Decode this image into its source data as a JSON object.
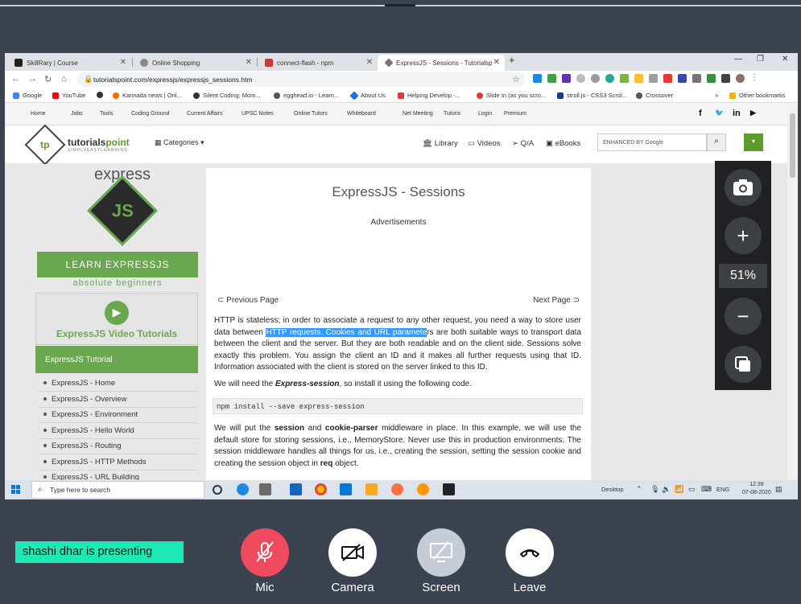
{
  "browser": {
    "tabs": [
      {
        "title": "SkillRary | Course",
        "color": "#222"
      },
      {
        "title": "Online Shopping",
        "color": "#666"
      },
      {
        "title": "connect-flash - npm",
        "color": "#cb3837"
      },
      {
        "title": "ExpressJS - Sessions - Tutorialsp",
        "color": "#777"
      }
    ],
    "tab_close": "✕",
    "new_tab": "+",
    "url": "tutorialspoint.com/expressjs/expressjs_sessions.htm",
    "bookmarks": [
      {
        "label": "Google",
        "color": "#4285f4"
      },
      {
        "label": "YouTube",
        "color": "#ff0000"
      },
      {
        "label": "",
        "color": "#333"
      },
      {
        "label": "Kannada news | Onl...",
        "color": "#ff6600"
      },
      {
        "label": "Silent Coding: Mom...",
        "color": "#333"
      },
      {
        "label": "egghead.io - Learn...",
        "color": "#555"
      },
      {
        "label": "About Us",
        "color": "#1a73e8"
      },
      {
        "label": "Helping Develop -...",
        "color": "#e53935"
      },
      {
        "label": "Slide In (as you scro...",
        "color": "#e53935"
      },
      {
        "label": "stroll.js - CSS3 Scrol...",
        "color": "#1a3a8a"
      },
      {
        "label": "Crossover",
        "color": "#555"
      }
    ],
    "bookmarks_more": "»",
    "other_bookmarks": "Other bookmarks"
  },
  "site": {
    "topnav": [
      "Home",
      "Jobs",
      "Tools",
      "Coding Ground",
      "Current Affairs",
      "UPSC Notes",
      "Online Tutors",
      "Whiteboard",
      "Net Meeting",
      "Tutorix",
      "Login",
      "Premium"
    ],
    "social": [
      "f",
      "🐦",
      "in",
      "▶"
    ],
    "logo_text_a": "tutorials",
    "logo_text_b": "point",
    "logo_tagline": "SIMPLYEASYLEARNING",
    "categories": "Categories",
    "header_links": [
      "Library",
      "Videos",
      "Q/A",
      "eBooks"
    ],
    "search_placeholder": "ENHANCED BY Google",
    "sidebar": {
      "express_word": "express",
      "js_mark": "JS",
      "learn": "LEARN EXPRESSJS",
      "absolute": "absolute beginners",
      "video_title": "ExpressJS Video Tutorials",
      "tutorial_heading": "ExpressJS Tutorial",
      "items": [
        "ExpressJS - Home",
        "ExpressJS - Overview",
        "ExpressJS - Environment",
        "ExpressJS - Hello World",
        "ExpressJS - Routing",
        "ExpressJS - HTTP Methods",
        "ExpressJS - URL Building"
      ]
    },
    "content": {
      "title": "ExpressJS - Sessions",
      "ads": "Advertisements",
      "prev": "Previous Page",
      "next": "Next Page",
      "p1_a": "HTTP is stateless; in order to associate a request to any other request, you need a way to store user data between ",
      "p1_hl": "HTTP requests. Cookies and URL paramete",
      "p1_b": "rs are both suitable ways to transport data between the client and the server. But they are both readable and on the client side. Sessions solve exactly this problem. You assign the client an ID and it makes all further requests using that ID. Information associated with the client is stored on the server linked to this ID.",
      "p2_a": "We will need the ",
      "p2_em": "Express-session",
      "p2_b": ", so install it using the following code.",
      "code": "npm install --save express-session",
      "p3_a": "We will put the ",
      "p3_b1": "session",
      "p3_c": " and ",
      "p3_b2": "cookie-parser",
      "p3_d": " middleware in place. In this example, we will use the default store for storing sessions, i.e., MemoryStore. Never use this in production environments. The session middleware handles all things for us, i.e., creating the session, setting the session cookie and creating the session object in ",
      "p3_b3": "req",
      "p3_e": " object."
    }
  },
  "taskbar": {
    "search": "Type here to search",
    "desktop": "Desktop",
    "lang": "ENG",
    "time": "12:39",
    "date": "07-08-2020"
  },
  "zoom": {
    "percent": "51%"
  },
  "meeting": {
    "presenting": "shashi dhar is presenting",
    "mic": "Mic",
    "camera": "Camera",
    "screen": "Screen",
    "leave": "Leave",
    "colors": {
      "mic": "#f04a5e",
      "camera": "#ffffff",
      "screen": "#c5ccd6",
      "leave": "#ffffff"
    }
  }
}
